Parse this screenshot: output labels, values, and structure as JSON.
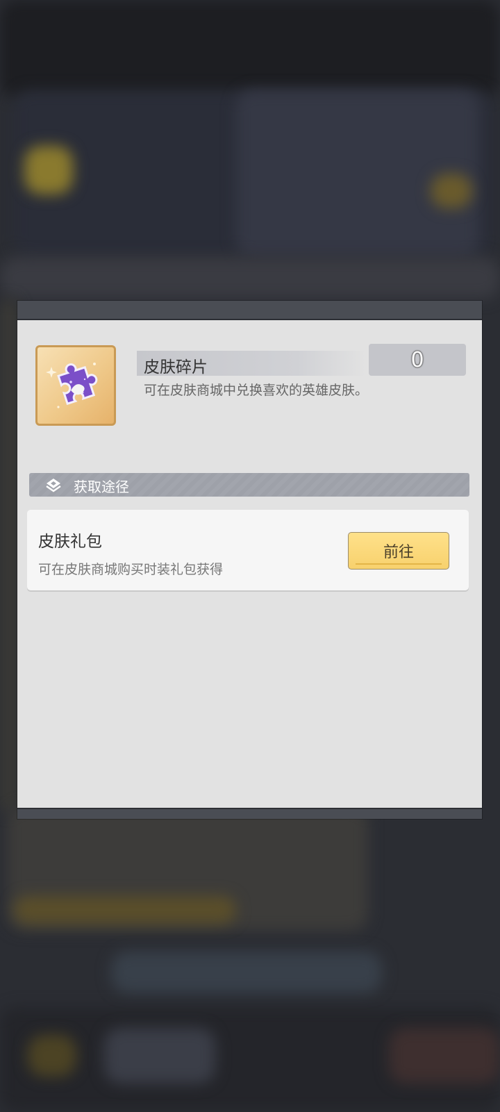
{
  "item": {
    "name": "皮肤碎片",
    "count": "0",
    "description": "可在皮肤商城中兑换喜欢的英雄皮肤。",
    "icon": "purple-puzzle-piece-icon"
  },
  "sources_section": {
    "title": "获取途径",
    "icon": "layers-chevron-icon"
  },
  "sources": [
    {
      "title": "皮肤礼包",
      "description": "可在皮肤商城购买时装礼包获得",
      "button_label": "前往"
    }
  ],
  "colors": {
    "dialog_bg": "#e2e2e2",
    "button_yellow": "#f7d16d",
    "section_bar": "#a1a4ac",
    "icon_frame": "#c99a55"
  }
}
